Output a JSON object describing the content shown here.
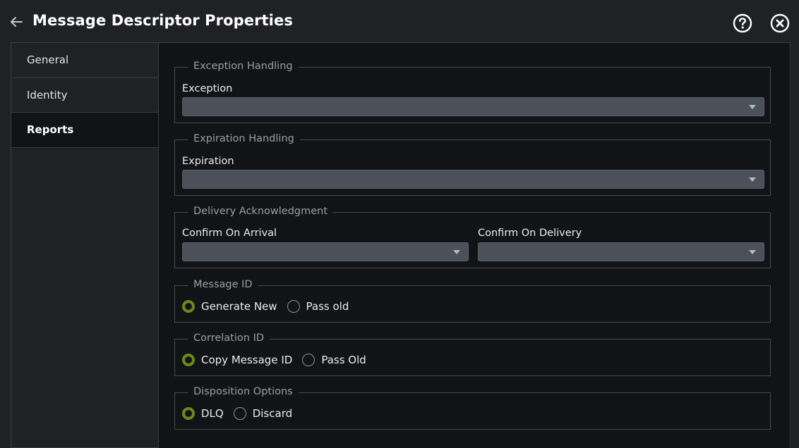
{
  "header": {
    "title": "Message Descriptor Properties",
    "back_icon": "arrow-left-icon",
    "help_icon": "question-circle-icon",
    "close_icon": "close-circle-icon"
  },
  "sidebar": {
    "items": [
      {
        "label": "General",
        "active": false
      },
      {
        "label": "Identity",
        "active": false
      },
      {
        "label": "Reports",
        "active": true
      }
    ]
  },
  "main": {
    "exception_handling": {
      "legend": "Exception Handling",
      "field_label": "Exception",
      "value": ""
    },
    "expiration_handling": {
      "legend": "Expiration Handling",
      "field_label": "Expiration",
      "value": ""
    },
    "delivery_ack": {
      "legend": "Delivery Acknowledgment",
      "confirm_arrival_label": "Confirm On Arrival",
      "confirm_arrival_value": "",
      "confirm_delivery_label": "Confirm On Delivery",
      "confirm_delivery_value": ""
    },
    "message_id": {
      "legend": "Message ID",
      "options": [
        "Generate New",
        "Pass old"
      ],
      "selected": "Generate New"
    },
    "correlation_id": {
      "legend": "Correlation ID",
      "options": [
        "Copy Message ID",
        "Pass Old"
      ],
      "selected": "Copy Message ID"
    },
    "disposition": {
      "legend": "Disposition Options",
      "options": [
        "DLQ",
        "Discard"
      ],
      "selected": "DLQ"
    }
  },
  "colors": {
    "background": "#202125",
    "panel": "#121316",
    "select": "#4c5058",
    "radio_checked": "#6b8a1c"
  }
}
